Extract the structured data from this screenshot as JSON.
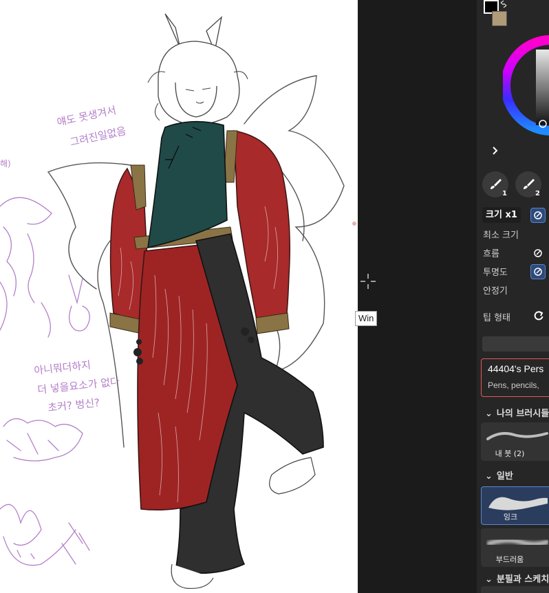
{
  "canvas": {
    "handwriting": {
      "note1_line1": "얘도 못생겨서",
      "note1_line2": "그려진일없음",
      "note2_line1": "아니뭐더하지",
      "note2_line2": "더 넣을요소가 없다",
      "note2_line3": "초커? 벙신?",
      "edge_note": "해)"
    }
  },
  "tooltip": {
    "text": "Win"
  },
  "colors": {
    "foreground": "#000000",
    "background": "#b09a78"
  },
  "panel": {
    "swap_icon": "swap-colors-icon",
    "expand_icon": "chevron-right-icon",
    "brush_slots": [
      {
        "num": "1"
      },
      {
        "num": "2"
      }
    ],
    "size_label": "크기 x1",
    "min_size_label": "최소 크기",
    "flow_label": "흐름",
    "opacity_label": "투명도",
    "stabilizer_label": "안정기",
    "tip_shape_label": "팁 형태",
    "reset_icon": "reset-icon",
    "promo": {
      "title": "44404's Pers",
      "subtitle": "Pens, pencils,"
    },
    "sections": {
      "my_brushes": "나의 브러시들",
      "general": "일반",
      "pen_sketch": "분필과 스케치"
    },
    "cards": {
      "my_brush": "내 붓 (2)",
      "ink": "잉크",
      "soft": "부드러움"
    }
  }
}
